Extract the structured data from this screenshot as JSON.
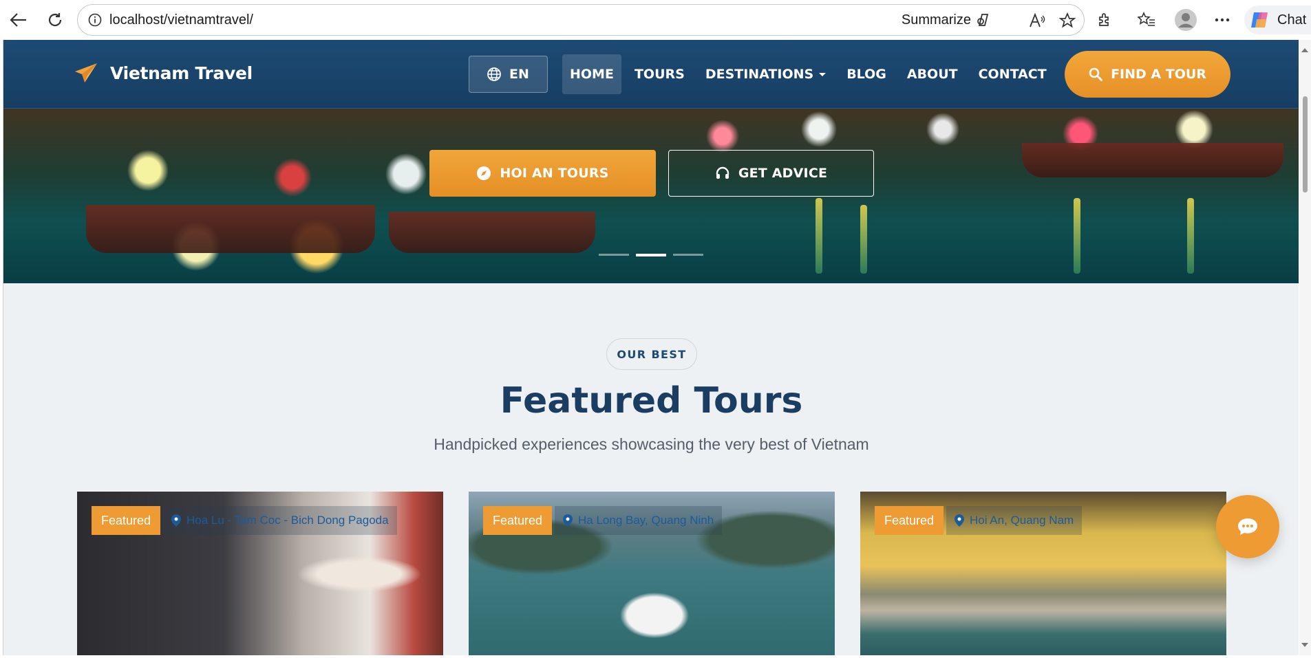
{
  "browser": {
    "url": "localhost/vietnamtravel/",
    "summarize_label": "Summarize",
    "chat_label": "Chat"
  },
  "header": {
    "logo_text": "Vietnam Travel",
    "lang_label": "EN",
    "nav": [
      {
        "label": "HOME",
        "active": true
      },
      {
        "label": "TOURS",
        "active": false
      },
      {
        "label": "DESTINATIONS",
        "active": false,
        "dropdown": true
      },
      {
        "label": "BLOG",
        "active": false
      },
      {
        "label": "ABOUT",
        "active": false
      },
      {
        "label": "CONTACT",
        "active": false
      }
    ],
    "find_tour_label": "FIND A TOUR"
  },
  "hero": {
    "primary_button": "HOI AN TOURS",
    "secondary_button": "GET ADVICE",
    "slides": 3,
    "active_slide": 2
  },
  "featured": {
    "badge": "OUR BEST",
    "title": "Featured Tours",
    "subtitle": "Handpicked experiences showcasing the very best of Vietnam",
    "cards": [
      {
        "badge": "Featured",
        "location": "Hoa Lu - Tam Coc - Bich Dong Pagoda"
      },
      {
        "badge": "Featured",
        "location": "Ha Long Bay, Quang Ninh"
      },
      {
        "badge": "Featured",
        "location": "Hoi An, Quang Nam"
      }
    ]
  },
  "colors": {
    "brand_navy": "#1d4a74",
    "accent_orange": "#ee9b33",
    "section_bg": "#eef1f4",
    "title_color": "#1b3d61"
  },
  "icons": {
    "logo": "paper-plane-icon",
    "lang": "globe-icon",
    "find": "search-icon",
    "primary_btn": "compass-icon",
    "secondary_btn": "headset-icon",
    "card_location": "map-pin-icon",
    "fab": "chat-bubble-icon"
  }
}
